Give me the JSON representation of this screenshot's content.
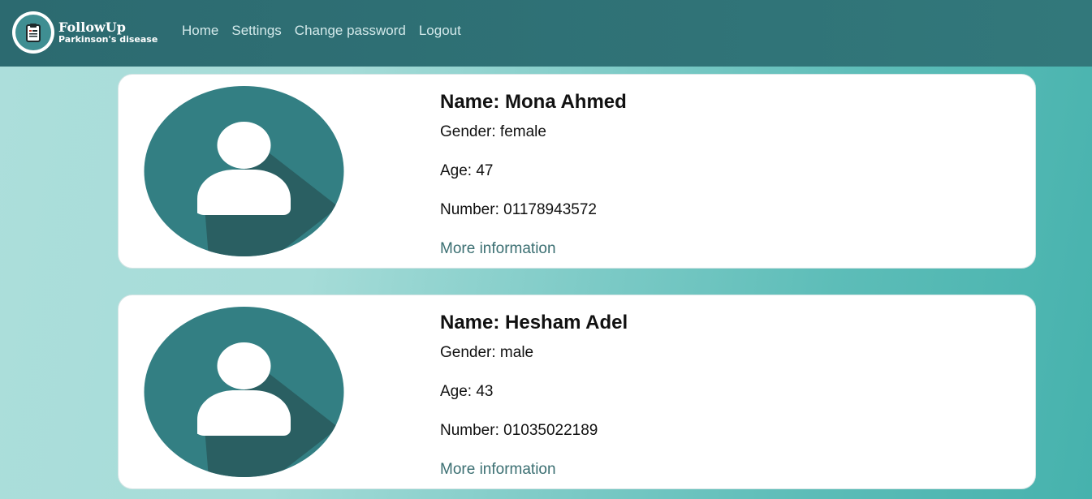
{
  "app": {
    "title": "FollowUp",
    "subtitle": "Parkinson's disease",
    "logo_icon": "clipboard-icon"
  },
  "nav": {
    "items": [
      {
        "label": "Home"
      },
      {
        "label": "Settings"
      },
      {
        "label": "Change password"
      },
      {
        "label": "Logout"
      }
    ]
  },
  "colors": {
    "navbar": "#2c6a70",
    "avatar_bg": "#337f83",
    "avatar_shadow": "#2a5f62",
    "link": "#3b6f72"
  },
  "patients": [
    {
      "name": "Name: Mona Ahmed",
      "gender": "Gender: female",
      "age": "Age: 47",
      "number": "Number: 01178943572",
      "more": "More information",
      "avatar_icon": "user-avatar-icon"
    },
    {
      "name": "Name: Hesham Adel",
      "gender": "Gender: male",
      "age": "Age: 43",
      "number": "Number: 01035022189",
      "more": "More information",
      "avatar_icon": "user-avatar-icon"
    }
  ]
}
